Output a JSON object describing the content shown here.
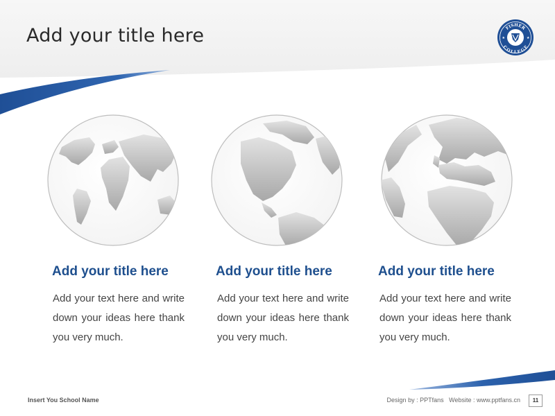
{
  "header": {
    "title": "Add your title here"
  },
  "logo": {
    "top_text": "FISHER",
    "bottom_text": "COLLEGE"
  },
  "cards": [
    {
      "title": "Add your title here",
      "text": "Add your text here and write down your ideas here thank you very much.",
      "globe_view": "globe-world-icon"
    },
    {
      "title": "Add your title here",
      "text": "Add your text here and write down your ideas here thank you very much.",
      "globe_view": "globe-americas-icon"
    },
    {
      "title": "Add your title here",
      "text": "Add your text here and write down your ideas here thank you very much.",
      "globe_view": "globe-europe-africa-icon"
    }
  ],
  "footer": {
    "school_name": "Insert You School Name",
    "design_label": "Design by : PPTfans",
    "website_label": "Website : www.pptfans.cn",
    "page_number": "11"
  },
  "colors": {
    "accent": "#1e4f8e",
    "swoosh": "#2a5ea8",
    "globe_land": "#b8b8b8"
  }
}
